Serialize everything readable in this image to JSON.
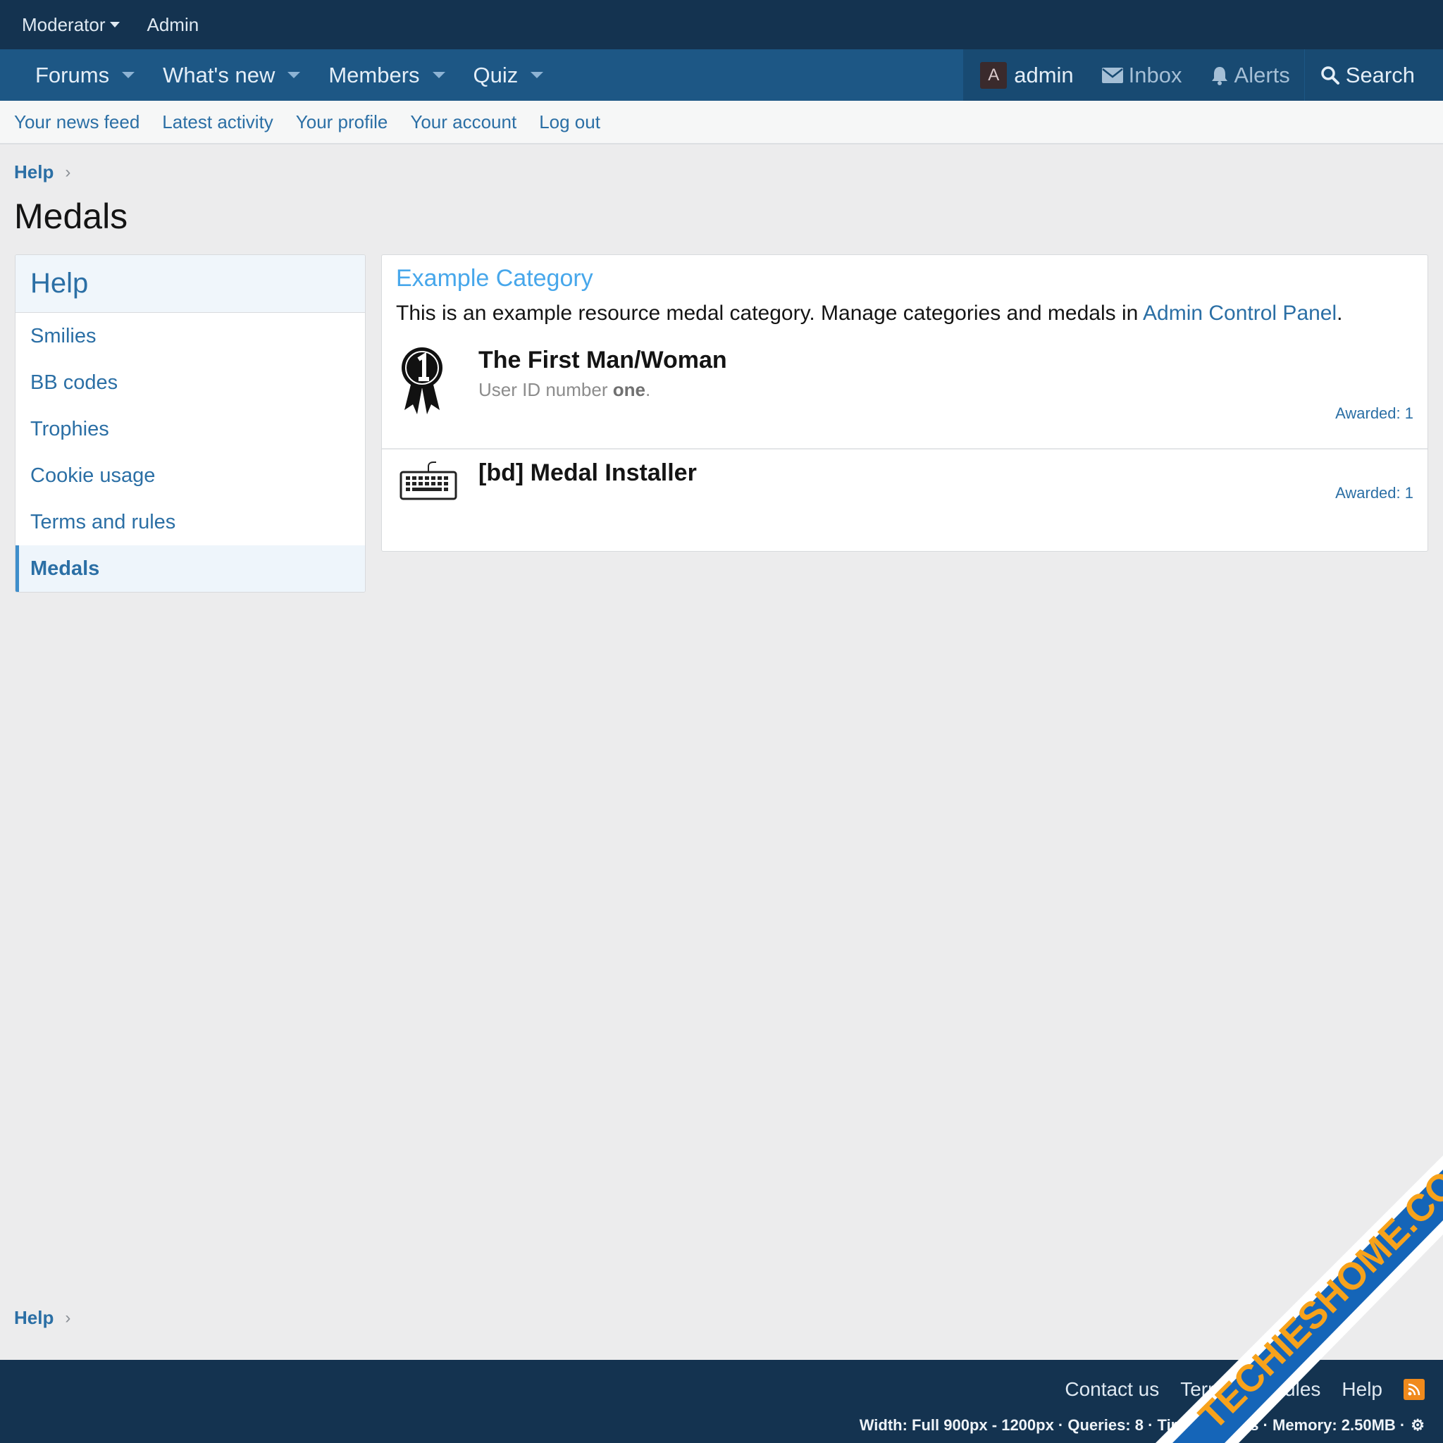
{
  "staff_bar": {
    "moderator_label": "Moderator",
    "admin_label": "Admin"
  },
  "nav": {
    "items": [
      {
        "label": "Forums"
      },
      {
        "label": "What's new"
      },
      {
        "label": "Members"
      },
      {
        "label": "Quiz"
      }
    ],
    "user": {
      "avatar_letter": "A",
      "name": "admin"
    },
    "inbox_label": "Inbox",
    "alerts_label": "Alerts",
    "search_label": "Search"
  },
  "subnav": {
    "items": [
      {
        "label": "Your news feed"
      },
      {
        "label": "Latest activity"
      },
      {
        "label": "Your profile"
      },
      {
        "label": "Your account"
      },
      {
        "label": "Log out"
      }
    ]
  },
  "breadcrumb": {
    "label": "Help"
  },
  "page_title": "Medals",
  "sidebar": {
    "title": "Help",
    "items": [
      {
        "label": "Smilies"
      },
      {
        "label": "BB codes"
      },
      {
        "label": "Trophies"
      },
      {
        "label": "Cookie usage"
      },
      {
        "label": "Terms and rules"
      },
      {
        "label": "Medals"
      }
    ]
  },
  "category": {
    "title": "Example Category",
    "desc_before": "This is an example resource medal category. Manage categories and medals in ",
    "desc_link": "Admin Control Panel",
    "desc_after": "."
  },
  "medals": [
    {
      "name": "The First Man/Woman",
      "desc_before": "User ID number ",
      "desc_bold": "one",
      "desc_after": ".",
      "awarded": "Awarded: 1",
      "icon": "ribbon-one-icon"
    },
    {
      "name": "[bd] Medal Installer",
      "awarded": "Awarded: 1",
      "icon": "keyboard-icon"
    }
  ],
  "footer": {
    "contact_label": "Contact us",
    "terms_label": "Terms and rules",
    "help_label": "Help",
    "debug_text": "Width: Full 900px - 1200px · Queries: 8 · Time: 0.0000s · Memory: 2.50MB ·"
  },
  "watermark": {
    "text": "TECHIESHOME.COM"
  },
  "colors": {
    "staff_bar": "#143350",
    "nav_bar": "#1d5785",
    "link": "#2b6fa5",
    "category_title": "#47a7eb",
    "watermark_bg": "#1565b8",
    "watermark_text": "#f7a21b"
  }
}
